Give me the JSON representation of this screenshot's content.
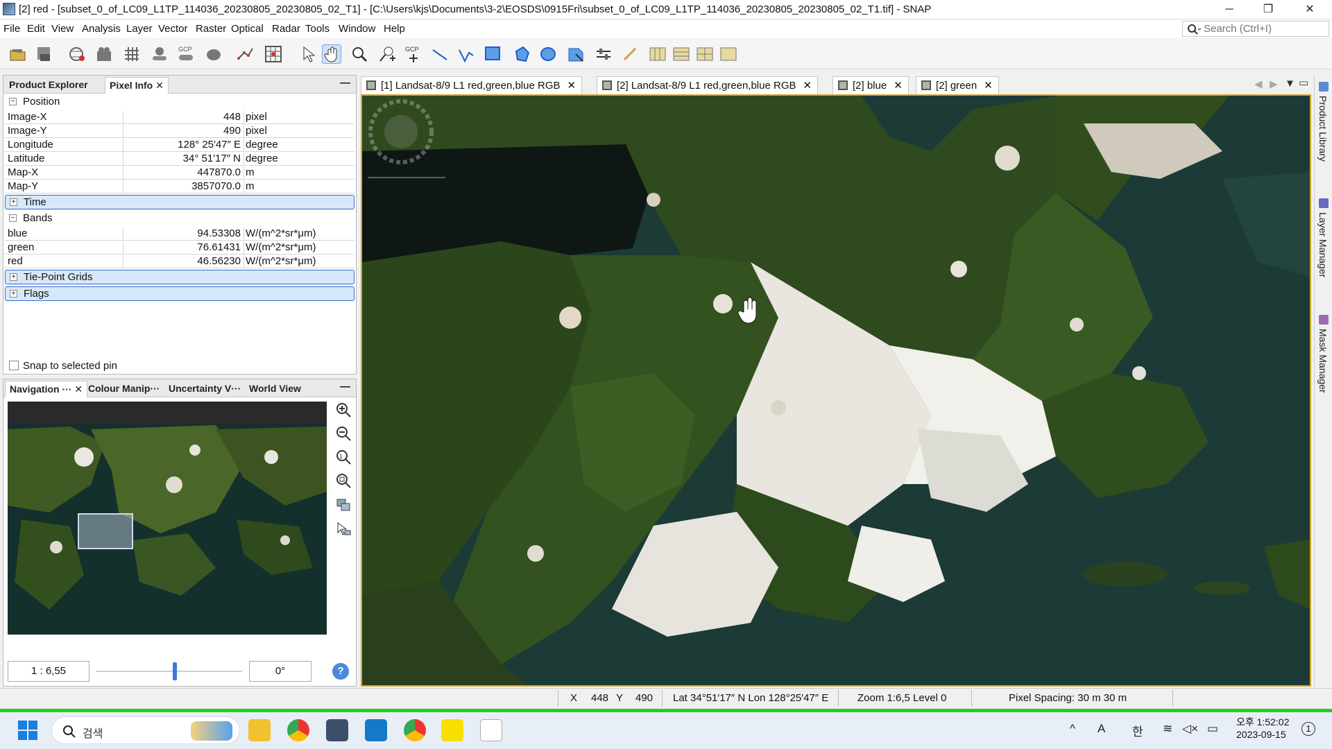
{
  "window": {
    "title": "[2] red - [subset_0_of_LC09_L1TP_114036_20230805_20230805_02_T1] - [C:\\Users\\kjs\\Documents\\3-2\\EOSDS\\0915Fri\\subset_0_of_LC09_L1TP_114036_20230805_20230805_02_T1.tif] - SNAP",
    "minimize": "─",
    "restore": "❐",
    "close": "✕"
  },
  "menu": [
    "File",
    "Edit",
    "View",
    "Analysis",
    "Layer",
    "Vector",
    "Raster",
    "Optical",
    "Radar",
    "Tools",
    "Window",
    "Help"
  ],
  "search": {
    "placeholder": "Search (Ctrl+I)"
  },
  "toolbar": {
    "icons": [
      "open-product-icon",
      "save-product-icon",
      "reprojection-icon",
      "export-icon",
      "graticule-icon",
      "pin-icon",
      "gcp-icon",
      "shape-icon",
      "pixel-geocoding-icon",
      "range-finder-icon",
      "select-tool-icon",
      "pan-tool-icon",
      "zoom-tool-icon",
      "pin-placing-icon",
      "gcp-placing-icon",
      "line-drawing-icon",
      "polyline-drawing-icon",
      "rectangle-drawing-icon",
      "polygon-drawing-icon",
      "ellipse-drawing-icon",
      "magic-wand-icon",
      "range-icon",
      "measure-icon",
      "tile-horizontal-icon",
      "tile-vertical-icon",
      "tile-grid-icon",
      "tile-window-icon"
    ],
    "gcp_label": "GCP"
  },
  "pixel_panel": {
    "tabs": [
      "Product Explorer",
      "Pixel Info"
    ],
    "active_tab": "Pixel Info",
    "position_group": "Position",
    "position_rows": [
      {
        "key": "Image-X",
        "value": "448",
        "unit": "pixel"
      },
      {
        "key": "Image-Y",
        "value": "490",
        "unit": "pixel"
      },
      {
        "key": "Longitude",
        "value": "128° 25′47″ E",
        "unit": "degree"
      },
      {
        "key": "Latitude",
        "value": "34° 51′17″ N",
        "unit": "degree"
      },
      {
        "key": "Map-X",
        "value": "447870.0",
        "unit": "m"
      },
      {
        "key": "Map-Y",
        "value": "3857070.0",
        "unit": "m"
      }
    ],
    "time_group": "Time",
    "bands_group": "Bands",
    "band_rows": [
      {
        "key": "blue",
        "value": "94.53308",
        "unit": "W/(m^2*sr*μm)"
      },
      {
        "key": "green",
        "value": "76.61431",
        "unit": "W/(m^2*sr*μm)"
      },
      {
        "key": "red",
        "value": "46.56230",
        "unit": "W/(m^2*sr*μm)"
      }
    ],
    "tiepoint_group": "Tie-Point Grids",
    "flags_group": "Flags",
    "snap_label": "Snap to selected pin"
  },
  "nav_panel": {
    "tabs": [
      "Navigation ···",
      "Colour Manip···",
      "Uncertainty V···",
      "World View"
    ],
    "scale": "1 : 6,55",
    "rotation": "0°",
    "help": "?"
  },
  "view_tabs": [
    {
      "label": "[1] Landsat-8/9 L1 red,green,blue RGB"
    },
    {
      "label": "[2] Landsat-8/9 L1 red,green,blue RGB"
    },
    {
      "label": "[2] blue"
    },
    {
      "label": "[2] green"
    }
  ],
  "right_sidebar": [
    "Product Library",
    "Layer Manager",
    "Mask Manager"
  ],
  "status": {
    "x_label": "X",
    "x_value": "448",
    "y_label": "Y",
    "y_value": "490",
    "latlon": "Lat 34°51′17″ N   Lon 128°25′47″ E",
    "zoom": "Zoom 1:6,5   Level 0",
    "spacing": "Pixel Spacing: 30 m  30 m"
  },
  "taskbar": {
    "search_label": "검색",
    "time": "오후 1:52:02",
    "date": "2023-09-15",
    "ime": "한",
    "lang": "A"
  }
}
